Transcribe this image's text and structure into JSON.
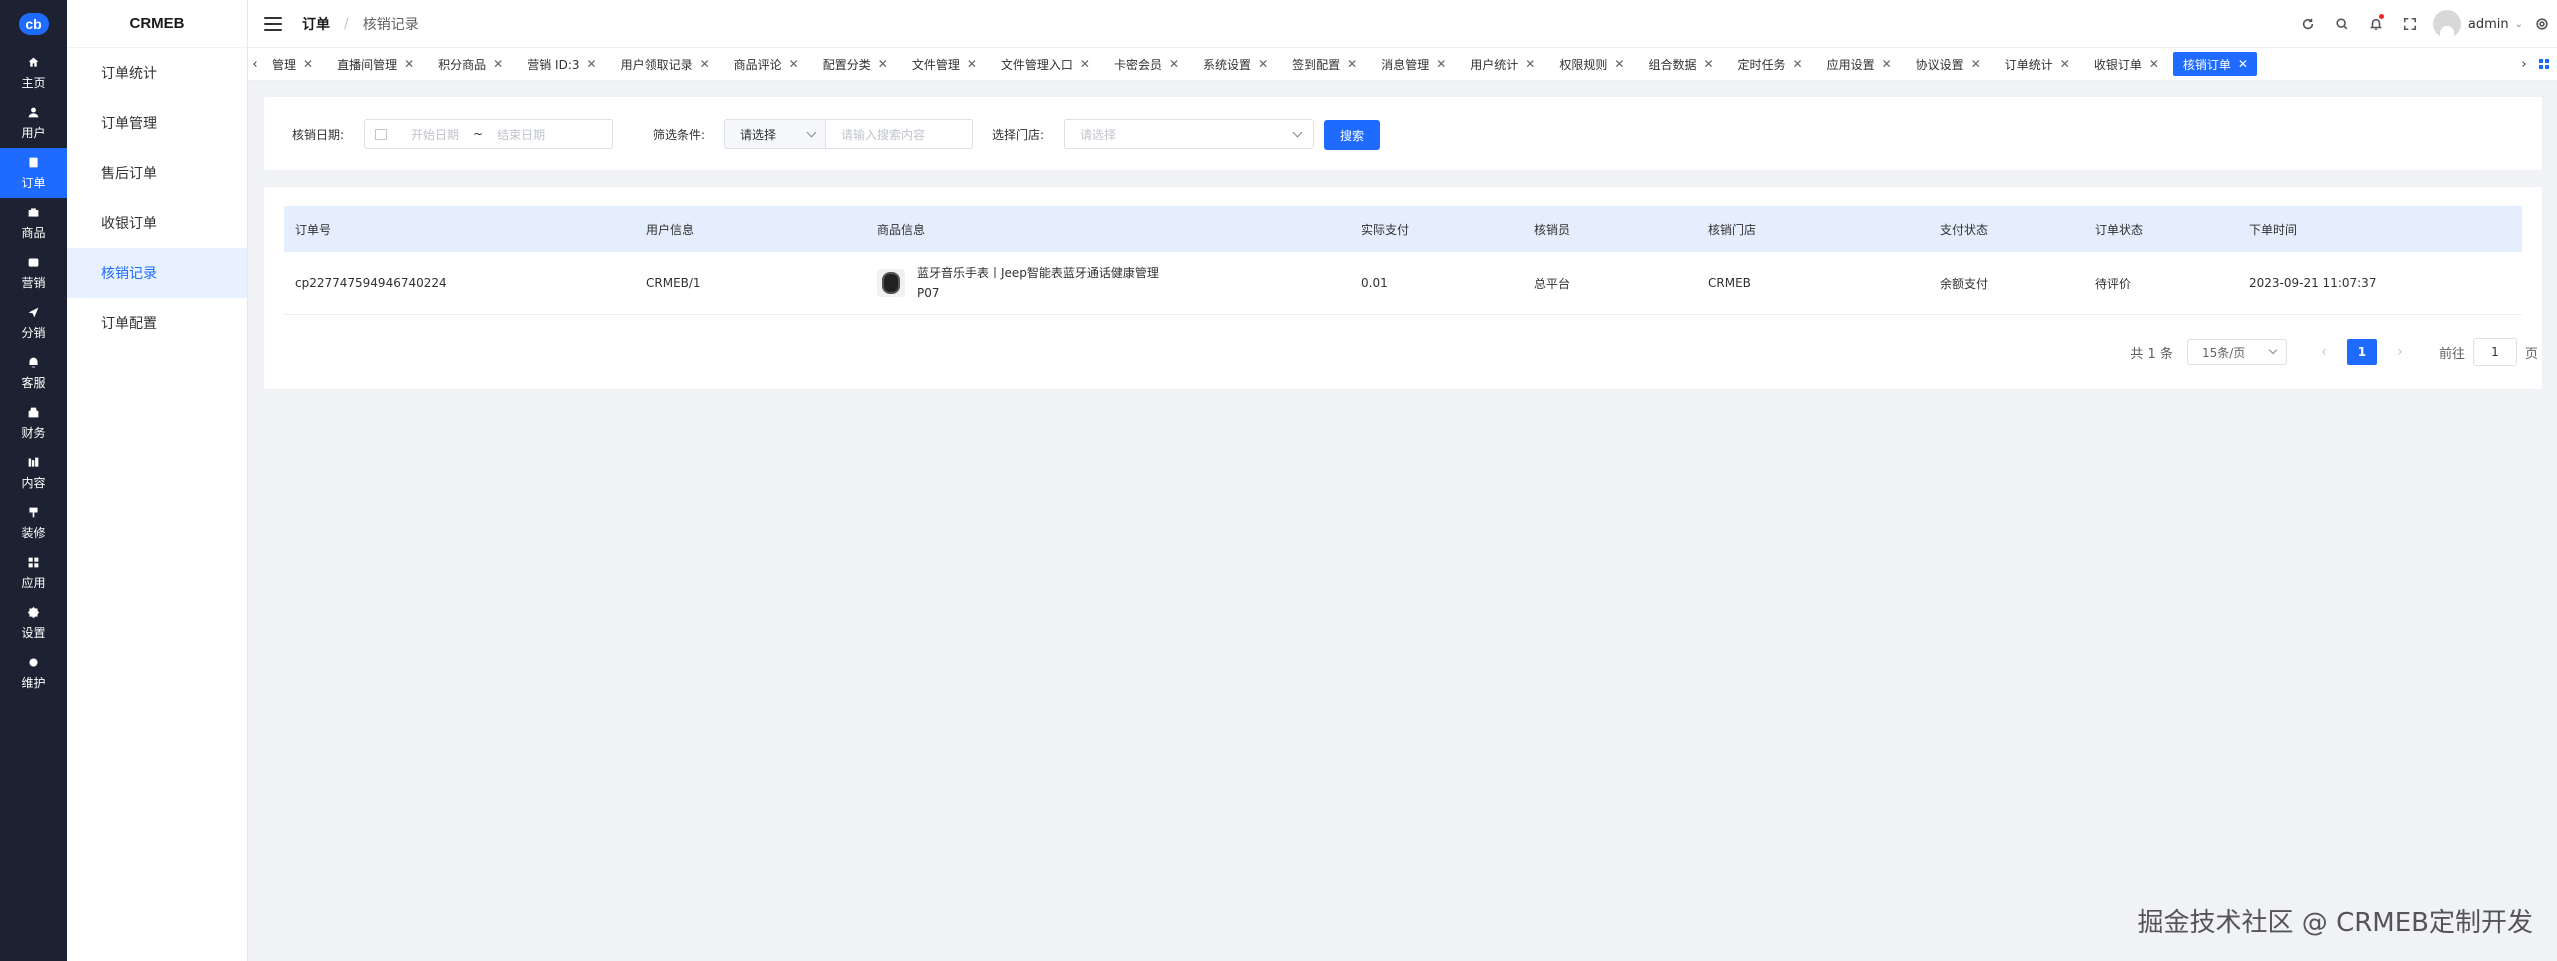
{
  "rail": {
    "logo": "cb",
    "items": [
      {
        "label": "主页",
        "icon": "home-icon"
      },
      {
        "label": "用户",
        "icon": "user-icon"
      },
      {
        "label": "订单",
        "icon": "order-icon"
      },
      {
        "label": "商品",
        "icon": "goods-icon"
      },
      {
        "label": "营销",
        "icon": "marketing-icon"
      },
      {
        "label": "分销",
        "icon": "distribution-icon"
      },
      {
        "label": "客服",
        "icon": "service-icon"
      },
      {
        "label": "财务",
        "icon": "finance-icon"
      },
      {
        "label": "内容",
        "icon": "content-icon"
      },
      {
        "label": "装修",
        "icon": "decorate-icon"
      },
      {
        "label": "应用",
        "icon": "apps-icon"
      },
      {
        "label": "设置",
        "icon": "settings-icon"
      },
      {
        "label": "维护",
        "icon": "maintenance-icon"
      }
    ],
    "active_index": 2
  },
  "submenu": {
    "brand": "CRMEB",
    "items": [
      "订单统计",
      "订单管理",
      "售后订单",
      "收银订单",
      "核销记录",
      "订单配置"
    ],
    "active_index": 4
  },
  "header": {
    "breadcrumb": [
      "订单",
      "核销记录"
    ],
    "separator": "/",
    "username": "admin"
  },
  "tabs": {
    "items": [
      "管理",
      "直播间管理",
      "积分商品",
      "营销 ID:3",
      "用户领取记录",
      "商品评论",
      "配置分类",
      "文件管理",
      "文件管理入口",
      "卡密会员",
      "系统设置",
      "签到配置",
      "消息管理",
      "用户统计",
      "权限规则",
      "组合数据",
      "定时任务",
      "应用设置",
      "协议设置",
      "订单统计",
      "收银订单",
      "核销订单"
    ],
    "active_index": 21,
    "close": "✕",
    "prev": "‹",
    "next": "›"
  },
  "filters": {
    "date_label": "核销日期:",
    "date_start_placeholder": "开始日期",
    "date_sep": "~",
    "date_end_placeholder": "结束日期",
    "condition_label": "筛选条件:",
    "condition_select": "请选择",
    "condition_input_placeholder": "请输入搜索内容",
    "store_label": "选择门店:",
    "store_select_placeholder": "请选择",
    "search_button": "搜索"
  },
  "table": {
    "headers": [
      "订单号",
      "用户信息",
      "商品信息",
      "实际支付",
      "核销员",
      "核销门店",
      "支付状态",
      "订单状态",
      "下单时间"
    ],
    "rows": [
      {
        "order_no": "cp227747594946740224",
        "user": "CRMEB/1",
        "product_line1": "蓝牙音乐手表丨Jeep智能表蓝牙通话健康管理",
        "product_line2": "P07",
        "paid": "0.01",
        "verifier": "总平台",
        "store": "CRMEB",
        "pay_status": "余额支付",
        "order_status": "待评价",
        "time": "2023-09-21 11:07:37"
      }
    ]
  },
  "pagination": {
    "total": "共 1 条",
    "page_size": "15条/页",
    "current": "1",
    "goto_label": "前往",
    "goto_value": "1",
    "page_suffix": "页",
    "prev": "‹",
    "next": "›"
  },
  "watermark": "掘金技术社区 @ CRMEB定制开发",
  "colors": {
    "accent": "#1f6bff",
    "rail_bg": "#1c2231",
    "table_header_bg": "#e5eefc"
  }
}
